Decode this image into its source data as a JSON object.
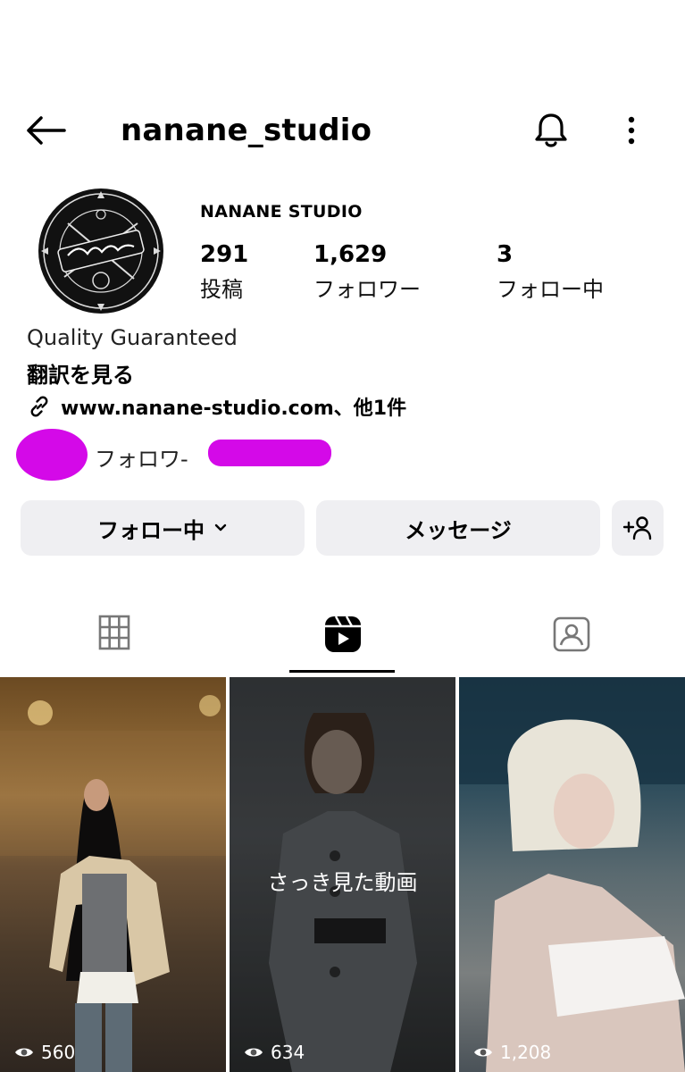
{
  "header": {
    "username": "nanane_studio"
  },
  "profile": {
    "display_name": "NANANE STUDIO",
    "stats": [
      {
        "value": "291",
        "label": "投稿"
      },
      {
        "value": "1,629",
        "label": "フォロワー"
      },
      {
        "value": "3",
        "label": "フォロー中"
      }
    ],
    "bio": "Quality Guaranteed",
    "translate_label": "翻訳を見る",
    "link_text": "www.nanane-studio.com、他1件",
    "mutual_text": "フォロワ-",
    "redaction_color": "#d409e8"
  },
  "actions": {
    "following_label": "フォロー中",
    "message_label": "メッセージ"
  },
  "tabs": [
    "grid-icon",
    "reels-icon",
    "tagged-icon"
  ],
  "active_tab": "reels",
  "reels": [
    {
      "views": "560",
      "overlay": ""
    },
    {
      "views": "634",
      "overlay": "さっき見た動画"
    },
    {
      "views": "1,208",
      "overlay": ""
    }
  ]
}
